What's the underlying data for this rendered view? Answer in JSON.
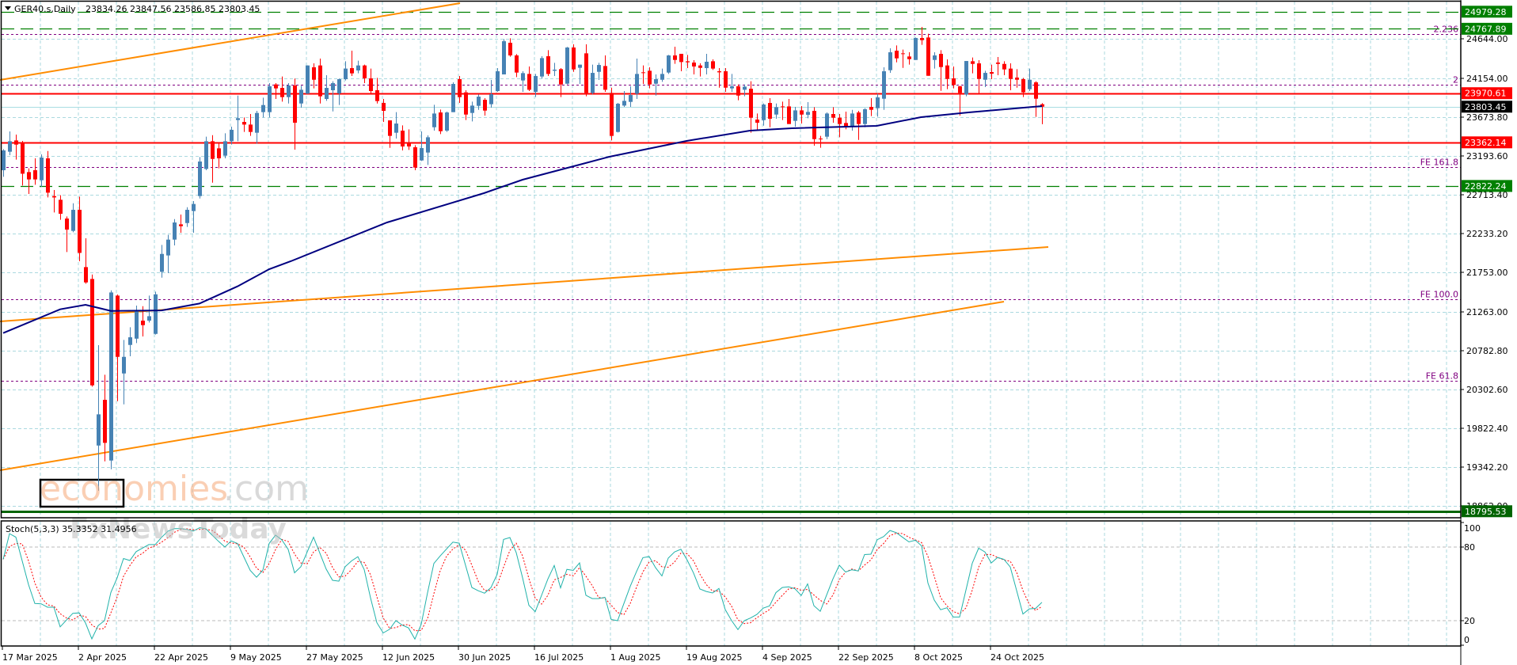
{
  "header": {
    "symbol_label": "GER40.s,Daily",
    "ohlc": "23834.26 23847.56 23586.85 23803.45"
  },
  "colors": {
    "bull": "#4682B4",
    "bear": "#FF0000",
    "ma": "#000080",
    "trend": "#FF8C00",
    "grid": "#ABD9DF",
    "stoch_main": "#20B2AA",
    "stoch_signal": "#FF0000",
    "fib": "#800080"
  },
  "price_axis": {
    "ticks": [
      "24644.00",
      "24154.00",
      "23673.80",
      "23193.60",
      "22713.40",
      "22233.20",
      "21753.00",
      "21263.00",
      "20782.80",
      "20302.60",
      "19822.40",
      "19342.20",
      "18862.00"
    ]
  },
  "levels": [
    {
      "price": 24979.28,
      "label": "24979.28",
      "line": "green-dash",
      "box": "#008000"
    },
    {
      "price": 24767.89,
      "label": "24767.89",
      "line": "green-dash",
      "box": "#008000"
    },
    {
      "price": 23970.61,
      "label": "23970.61",
      "line": "red-solid",
      "box": "#FF0000"
    },
    {
      "price": 23803.45,
      "label": "23803.45",
      "line": "current",
      "box": "#000000"
    },
    {
      "price": 23362.14,
      "label": "23362.14",
      "line": "red-solid",
      "box": "#FF0000"
    },
    {
      "price": 22822.24,
      "label": "22822.24",
      "line": "green-dash",
      "box": "#008000"
    },
    {
      "price": 18795.53,
      "label": "18795.53",
      "line": "green-thick",
      "box": "#006400"
    }
  ],
  "fib_levels": [
    {
      "price": 24706,
      "label": "2.236"
    },
    {
      "price": 24073,
      "label": "2"
    },
    {
      "price": 23056,
      "label": "FE 161.8"
    },
    {
      "price": 21420,
      "label": "FE 100.0"
    },
    {
      "price": 20410,
      "label": "FE 61.8"
    }
  ],
  "candles": [
    [
      23017,
      23278,
      22935,
      23262
    ],
    [
      23246,
      23497,
      23203,
      23376
    ],
    [
      23386,
      23458,
      23148,
      23334
    ],
    [
      23353,
      23380,
      22827,
      22974
    ],
    [
      22994,
      23040,
      22723,
      22903
    ],
    [
      23017,
      23164,
      22837,
      22903
    ],
    [
      22893,
      23213,
      22811,
      23174
    ],
    [
      23164,
      23255,
      22680,
      22739
    ],
    [
      22697,
      22772,
      22494,
      22680
    ],
    [
      22651,
      22707,
      22403,
      22478
    ],
    [
      22419,
      22445,
      22004,
      22282
    ],
    [
      22266,
      22608,
      22249,
      22527
    ],
    [
      22527,
      22690,
      21890,
      21994
    ],
    [
      21818,
      22174,
      21612,
      21628
    ],
    [
      21671,
      21726,
      20338,
      20354
    ],
    [
      19609,
      20851,
      19050,
      19995
    ],
    [
      20175,
      20485,
      19413,
      19642
    ],
    [
      19423,
      21530,
      19315,
      21504
    ],
    [
      21465,
      21478,
      20158,
      20707
    ],
    [
      20501,
      20916,
      20119,
      20707
    ],
    [
      20854,
      21073,
      20714,
      20949
    ],
    [
      20932,
      21341,
      20877,
      21269
    ],
    [
      21155,
      21334,
      20959,
      21099
    ],
    [
      21155,
      21465,
      21132,
      21210
    ],
    [
      20991,
      21514,
      20982,
      21481
    ],
    [
      21759,
      22092,
      21687,
      21981
    ],
    [
      21962,
      22217,
      21743,
      22158
    ],
    [
      22158,
      22412,
      22086,
      22370
    ],
    [
      22347,
      22468,
      22243,
      22324
    ],
    [
      22363,
      22559,
      22315,
      22527
    ],
    [
      22511,
      22635,
      22243,
      22599
    ],
    [
      22697,
      23180,
      22667,
      23125
    ],
    [
      23033,
      23432,
      23017,
      23376
    ],
    [
      23376,
      23451,
      22863,
      23157
    ],
    [
      23288,
      23360,
      23040,
      23164
    ],
    [
      23197,
      23474,
      23164,
      23376
    ],
    [
      23376,
      23556,
      23334,
      23517
    ],
    [
      23638,
      23941,
      23376,
      23661
    ],
    [
      23615,
      23670,
      23491,
      23582
    ],
    [
      23582,
      23713,
      23442,
      23491
    ],
    [
      23481,
      23752,
      23344,
      23726
    ],
    [
      23736,
      23915,
      23670,
      23824
    ],
    [
      23736,
      24095,
      23670,
      24056
    ],
    [
      24079,
      24095,
      23899,
      24030
    ],
    [
      24036,
      24177,
      23866,
      23922
    ],
    [
      23922,
      24095,
      23843,
      24066
    ],
    [
      24066,
      24151,
      23272,
      23605
    ],
    [
      23843,
      24062,
      23791,
      24013
    ],
    [
      23964,
      24314,
      23964,
      24314
    ],
    [
      24291,
      24340,
      24030,
      24137
    ],
    [
      24314,
      24399,
      23843,
      23932
    ],
    [
      23899,
      24193,
      23876,
      24036
    ],
    [
      24007,
      24118,
      23745,
      24095
    ],
    [
      23968,
      24151,
      23824,
      24144
    ],
    [
      24144,
      24366,
      24128,
      24275
    ],
    [
      24281,
      24497,
      24183,
      24216
    ],
    [
      24252,
      24373,
      24216,
      24314
    ],
    [
      24314,
      24324,
      24095,
      24154
    ],
    [
      24154,
      24275,
      23958,
      23997
    ],
    [
      24007,
      24160,
      23843,
      23873
    ],
    [
      23850,
      23899,
      23615,
      23752
    ],
    [
      23634,
      23634,
      23294,
      23442
    ],
    [
      23481,
      23736,
      23409,
      23595
    ],
    [
      23507,
      23572,
      23262,
      23311
    ],
    [
      23350,
      23523,
      23268,
      23311
    ],
    [
      23301,
      23327,
      23017,
      23050
    ],
    [
      23138,
      23497,
      23131,
      23291
    ],
    [
      23236,
      23448,
      23082,
      23425
    ],
    [
      23549,
      23827,
      23507,
      23719
    ],
    [
      23732,
      23768,
      23464,
      23500
    ],
    [
      23507,
      23742,
      23491,
      23732
    ],
    [
      23736,
      24105,
      23736,
      24085
    ],
    [
      24144,
      24183,
      23850,
      23922
    ],
    [
      23981,
      24007,
      23638,
      23706
    ],
    [
      23726,
      23866,
      23621,
      23817
    ],
    [
      23814,
      23954,
      23765,
      23928
    ],
    [
      23889,
      23909,
      23693,
      23755
    ],
    [
      23834,
      24134,
      23791,
      23958
    ],
    [
      23997,
      24281,
      23987,
      24242
    ],
    [
      24203,
      24640,
      24203,
      24614
    ],
    [
      24595,
      24650,
      24422,
      24438
    ],
    [
      24438,
      24454,
      24170,
      24226
    ],
    [
      24128,
      24242,
      23987,
      24219
    ],
    [
      24209,
      24301,
      23997,
      24013
    ],
    [
      23987,
      24209,
      23922,
      24183
    ],
    [
      24177,
      24428,
      24154,
      24405
    ],
    [
      24428,
      24503,
      24183,
      24209
    ],
    [
      24248,
      24346,
      24183,
      24262
    ],
    [
      24268,
      24281,
      23922,
      24079
    ],
    [
      24088,
      24543,
      24079,
      24536
    ],
    [
      24536,
      24575,
      24235,
      24265
    ],
    [
      24285,
      24324,
      24085,
      24324
    ],
    [
      24464,
      24575,
      23932,
      23974
    ],
    [
      23974,
      24324,
      23958,
      24222
    ],
    [
      24235,
      24346,
      24134,
      24320
    ],
    [
      24307,
      24438,
      23987,
      24013
    ],
    [
      23974,
      24039,
      23386,
      23442
    ],
    [
      23491,
      23850,
      23484,
      23840
    ],
    [
      23817,
      23997,
      23801,
      23876
    ],
    [
      23863,
      24056,
      23801,
      23948
    ],
    [
      23964,
      24399,
      23899,
      24209
    ],
    [
      24229,
      24314,
      24085,
      24226
    ],
    [
      24248,
      24291,
      24030,
      24079
    ],
    [
      24088,
      24203,
      23941,
      24144
    ],
    [
      24137,
      24275,
      24111,
      24209
    ],
    [
      24226,
      24444,
      24209,
      24438
    ],
    [
      24438,
      24546,
      24334,
      24382
    ],
    [
      24458,
      24458,
      24242,
      24356
    ],
    [
      24366,
      24444,
      24281,
      24353
    ],
    [
      24350,
      24379,
      24203,
      24301
    ],
    [
      24314,
      24340,
      24177,
      24284
    ],
    [
      24281,
      24458,
      24203,
      24360
    ],
    [
      24366,
      24389,
      24258,
      24275
    ],
    [
      24242,
      24281,
      24039,
      24229
    ],
    [
      24242,
      24281,
      23987,
      24039
    ],
    [
      24030,
      24209,
      23987,
      24056
    ],
    [
      24056,
      24079,
      23883,
      23941
    ],
    [
      24013,
      24079,
      23932,
      24052
    ],
    [
      24026,
      24118,
      23481,
      23667
    ],
    [
      23644,
      23719,
      23507,
      23605
    ],
    [
      23637,
      23843,
      23569,
      23830
    ],
    [
      23850,
      23909,
      23549,
      23654
    ],
    [
      23706,
      23843,
      23654,
      23798
    ],
    [
      23807,
      23866,
      23638,
      23804
    ],
    [
      23807,
      23899,
      23589,
      23589
    ],
    [
      23628,
      23801,
      23556,
      23758
    ],
    [
      23758,
      23811,
      23595,
      23706
    ],
    [
      23703,
      23860,
      23660,
      23739
    ],
    [
      23752,
      23798,
      23321,
      23402
    ],
    [
      23409,
      23442,
      23295,
      23402
    ],
    [
      23432,
      23732,
      23402,
      23719
    ],
    [
      23713,
      23798,
      23605,
      23667
    ],
    [
      23667,
      23713,
      23425,
      23589
    ],
    [
      23602,
      23742,
      23523,
      23549
    ],
    [
      23556,
      23765,
      23507,
      23719
    ],
    [
      23732,
      23752,
      23392,
      23589
    ],
    [
      23589,
      23785,
      23549,
      23772
    ],
    [
      23801,
      23909,
      23687,
      23765
    ],
    [
      23785,
      23964,
      23680,
      23919
    ],
    [
      23902,
      24291,
      23765,
      24242
    ],
    [
      24255,
      24526,
      24222,
      24477
    ],
    [
      24497,
      24562,
      24353,
      24402
    ],
    [
      24464,
      24510,
      24284,
      24461
    ],
    [
      24425,
      24477,
      24324,
      24392
    ],
    [
      24382,
      24660,
      24382,
      24654
    ],
    [
      24654,
      24791,
      24569,
      24627
    ],
    [
      24660,
      24706,
      24186,
      24186
    ],
    [
      24382,
      24477,
      24275,
      24438
    ],
    [
      24458,
      24503,
      24000,
      24294
    ],
    [
      24314,
      24389,
      24020,
      24147
    ],
    [
      24154,
      24301,
      24030,
      24072
    ],
    [
      24056,
      24062,
      23693,
      23974
    ],
    [
      23954,
      24369,
      23932,
      24369
    ],
    [
      24366,
      24412,
      24216,
      24333
    ],
    [
      24340,
      24379,
      23954,
      24147
    ],
    [
      24137,
      24248,
      24046,
      24222
    ],
    [
      24232,
      24324,
      24144,
      24212
    ],
    [
      24350,
      24418,
      24193,
      24333
    ],
    [
      24333,
      24366,
      24193,
      24265
    ],
    [
      24275,
      24340,
      24007,
      24147
    ],
    [
      24164,
      24268,
      24039,
      24137
    ],
    [
      24144,
      24160,
      23922,
      23981
    ],
    [
      24020,
      24275,
      23997,
      24137
    ],
    [
      24105,
      24118,
      23677,
      23902
    ],
    [
      23834.26,
      23847.56,
      23586.85,
      23803.45
    ]
  ],
  "moving_average": [
    [
      1,
      21001
    ],
    [
      10,
      21295
    ],
    [
      14,
      21351
    ],
    [
      18,
      21276
    ],
    [
      26,
      21282
    ],
    [
      32,
      21367
    ],
    [
      38,
      21580
    ],
    [
      43,
      21792
    ],
    [
      46.4,
      21890
    ],
    [
      61.6,
      22370
    ],
    [
      76.9,
      22733
    ],
    [
      83,
      22900
    ],
    [
      92,
      23086
    ],
    [
      96.7,
      23184
    ],
    [
      108.9,
      23380
    ],
    [
      118.9,
      23507
    ],
    [
      125.5,
      23537
    ],
    [
      138.9,
      23566
    ],
    [
      145.9,
      23674
    ],
    [
      153.4,
      23733
    ],
    [
      165,
      23811
    ]
  ],
  "stochastic": {
    "label": "Stoch(5,3,3) 35.3352 31.4956",
    "signal_period": 3,
    "levels": [
      80,
      20
    ],
    "axis_labels": [
      "100",
      "80",
      "20",
      "0"
    ],
    "main": [
      [
        1,
        70
      ],
      [
        1.9,
        91
      ],
      [
        2.9,
        90
      ],
      [
        5.8,
        34
      ],
      [
        6.9,
        34
      ],
      [
        8,
        31
      ],
      [
        9,
        31
      ],
      [
        10,
        15
      ],
      [
        12,
        26
      ],
      [
        12.9,
        27
      ],
      [
        13.9,
        20
      ],
      [
        14.8,
        3
      ],
      [
        16,
        16
      ],
      [
        17,
        20
      ],
      [
        18,
        43
      ],
      [
        18.9,
        53
      ],
      [
        19.8,
        71
      ],
      [
        21,
        69
      ],
      [
        21.9,
        76
      ],
      [
        24,
        82
      ],
      [
        25,
        82
      ],
      [
        26.7,
        92
      ],
      [
        27.7,
        95
      ],
      [
        29.6,
        95
      ],
      [
        31,
        93
      ],
      [
        32.1,
        96
      ],
      [
        33,
        95
      ],
      [
        34.7,
        86
      ],
      [
        36,
        80
      ],
      [
        37,
        85
      ],
      [
        37.9,
        84
      ],
      [
        40,
        61
      ],
      [
        40.9,
        55
      ],
      [
        41.9,
        59
      ],
      [
        43,
        83
      ],
      [
        44.2,
        91
      ],
      [
        45.9,
        80
      ],
      [
        47,
        59
      ],
      [
        48,
        64
      ],
      [
        50,
        88
      ],
      [
        52,
        62
      ],
      [
        53.1,
        52
      ],
      [
        53.9,
        51
      ],
      [
        55,
        64
      ],
      [
        56.9,
        73
      ],
      [
        57.9,
        64
      ],
      [
        59.8,
        20
      ],
      [
        61,
        10
      ],
      [
        62,
        13
      ],
      [
        63,
        20
      ],
      [
        64.1,
        16
      ],
      [
        64.9,
        15
      ],
      [
        66,
        5
      ],
      [
        67,
        17
      ],
      [
        68.9,
        66
      ],
      [
        70.2,
        74
      ],
      [
        72,
        84
      ],
      [
        72.9,
        85
      ],
      [
        75,
        47
      ],
      [
        76.9,
        42
      ],
      [
        77.9,
        46
      ],
      [
        78.9,
        55
      ],
      [
        80.1,
        89
      ],
      [
        80.9,
        89
      ],
      [
        82.2,
        73
      ],
      [
        83,
        55
      ],
      [
        83.8,
        34
      ],
      [
        84.9,
        26
      ],
      [
        87,
        54
      ],
      [
        88,
        65
      ],
      [
        88.9,
        45
      ],
      [
        89.9,
        62
      ],
      [
        90.9,
        60
      ],
      [
        91.9,
        70
      ],
      [
        92.9,
        41
      ],
      [
        94,
        38
      ],
      [
        95,
        38
      ],
      [
        96,
        39
      ],
      [
        97,
        21
      ],
      [
        98,
        20
      ],
      [
        100,
        48
      ],
      [
        101.9,
        71
      ],
      [
        102.8,
        74
      ],
      [
        104.9,
        55
      ],
      [
        106,
        71
      ],
      [
        107.8,
        80
      ],
      [
        109.7,
        63
      ],
      [
        110.9,
        46
      ],
      [
        112.9,
        42
      ],
      [
        113.9,
        48
      ],
      [
        115,
        29
      ],
      [
        116.9,
        12
      ],
      [
        118,
        20
      ],
      [
        119.8,
        24
      ],
      [
        120.9,
        30
      ],
      [
        122,
        32
      ],
      [
        123.2,
        45
      ],
      [
        124,
        47
      ],
      [
        125.8,
        48
      ],
      [
        126.8,
        38
      ],
      [
        127.9,
        52
      ],
      [
        128.8,
        34
      ],
      [
        129.8,
        25
      ],
      [
        132,
        54
      ],
      [
        132.9,
        66
      ],
      [
        133.8,
        59
      ],
      [
        134.8,
        62
      ],
      [
        135.9,
        59
      ],
      [
        136.9,
        74
      ],
      [
        137.9,
        73
      ],
      [
        139,
        86
      ],
      [
        139.9,
        88
      ],
      [
        141.1,
        94
      ],
      [
        142.3,
        91
      ],
      [
        143.9,
        84
      ],
      [
        144.9,
        86
      ],
      [
        146,
        81
      ],
      [
        146.9,
        52
      ],
      [
        148.2,
        34
      ],
      [
        149.3,
        27
      ],
      [
        150.1,
        31
      ],
      [
        151,
        23
      ],
      [
        152,
        23
      ],
      [
        154.1,
        69
      ],
      [
        155,
        79
      ],
      [
        156,
        76
      ],
      [
        157,
        67
      ],
      [
        158.1,
        72
      ],
      [
        159.4,
        69
      ],
      [
        160.2,
        62
      ],
      [
        161.9,
        25
      ],
      [
        163.1,
        30
      ],
      [
        164,
        30
      ],
      [
        165,
        35
      ]
    ]
  },
  "dates": [
    "17 Mar 2025",
    "2 Apr 2025",
    "22 Apr 2025",
    "9 May 2025",
    "27 May 2025",
    "12 Jun 2025",
    "30 Jun 2025",
    "16 Jul 2025",
    "1 Aug 2025",
    "19 Aug 2025",
    "4 Sep 2025",
    "22 Sep 2025",
    "8 Oct 2025",
    "24 Oct 2025"
  ],
  "watermark": {
    "brand_main": "economies",
    "brand_suffix": ".com",
    "secondary": "FxNewsToday"
  }
}
